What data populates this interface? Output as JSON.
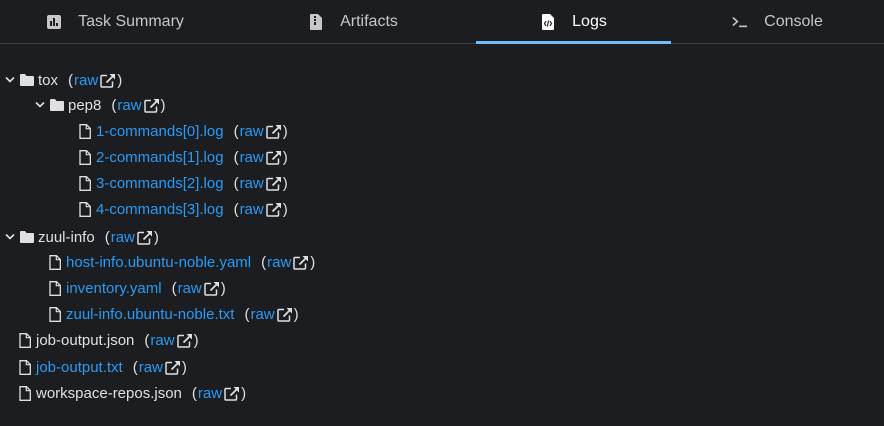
{
  "tabs": [
    {
      "label": "Task Summary",
      "icon": "chart-icon",
      "active": false
    },
    {
      "label": "Artifacts",
      "icon": "file-zip-icon",
      "active": false
    },
    {
      "label": "Logs",
      "icon": "file-code-icon",
      "active": true
    },
    {
      "label": "Console",
      "icon": "terminal-icon",
      "active": false
    }
  ],
  "raw_label": "raw",
  "paren_open": "(",
  "paren_close": ")",
  "tree": [
    {
      "name": "tox",
      "type": "folder",
      "expanded": true
    },
    {
      "name": "pep8",
      "type": "folder",
      "expanded": true
    },
    {
      "name": "1-commands[0].log",
      "type": "file",
      "linked": true
    },
    {
      "name": "2-commands[1].log",
      "type": "file",
      "linked": true
    },
    {
      "name": "3-commands[2].log",
      "type": "file",
      "linked": true
    },
    {
      "name": "4-commands[3].log",
      "type": "file",
      "linked": true
    },
    {
      "name": "zuul-info",
      "type": "folder",
      "expanded": true
    },
    {
      "name": "host-info.ubuntu-noble.yaml",
      "type": "file",
      "linked": true
    },
    {
      "name": "inventory.yaml",
      "type": "file",
      "linked": true
    },
    {
      "name": "zuul-info.ubuntu-noble.txt",
      "type": "file",
      "linked": true
    },
    {
      "name": "job-output.json",
      "type": "file",
      "linked": false
    },
    {
      "name": "job-output.txt",
      "type": "file",
      "linked": true
    },
    {
      "name": "workspace-repos.json",
      "type": "file",
      "linked": false
    }
  ],
  "colors": {
    "accent": "#73bcf7",
    "link": "#2b9af3",
    "background": "#1b1d21"
  }
}
